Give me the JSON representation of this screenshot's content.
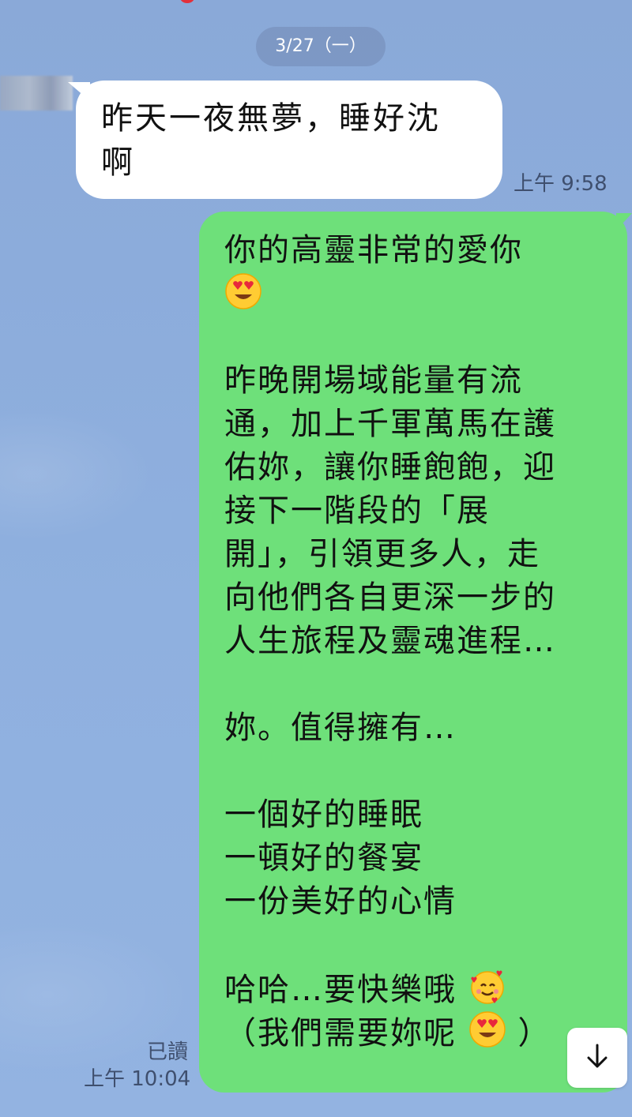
{
  "date_separator": "3/27（一）",
  "incoming": {
    "lines": [
      "昨天一夜無夢，睡好沈",
      "啊"
    ],
    "time": "上午 9:58"
  },
  "outgoing": {
    "lines": [
      "你的高靈非常的愛你",
      "",
      "",
      "昨晚開場域能量有流",
      "通，加上千軍萬馬在護",
      "佑妳，讓你睡飽飽，迎",
      "接下一階段的「展",
      "開」，引領更多人，走",
      "向他們各自更深一步的",
      "人生旅程及靈魂進程…",
      "",
      "妳。值得擁有…",
      "",
      "一個好的睡眠",
      "一頓好的餐宴",
      "一份美好的心情",
      "",
      "哈哈…要快樂哦",
      "（我們需要妳呢",
      "）"
    ],
    "read_label": "已讀",
    "time": "上午 10:04"
  },
  "icons": {
    "heart_eyes": "heart-eyes-emoji",
    "smiling_hearts": "smiling-face-with-hearts-emoji",
    "scroll_down": "arrow-down-icon"
  },
  "colors": {
    "background": "#8aa9d8",
    "incoming_bubble": "#ffffff",
    "outgoing_bubble": "#6ee07a",
    "meta_text": "#3f4f6e"
  }
}
